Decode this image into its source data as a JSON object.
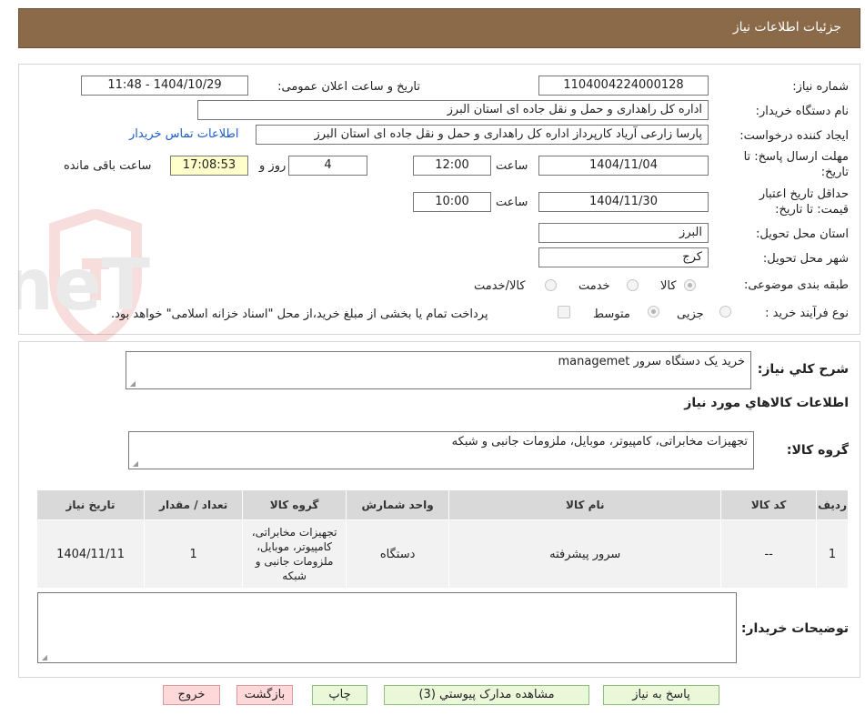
{
  "header": {
    "title": "جزئیات اطلاعات نیاز"
  },
  "form": {
    "need_number": {
      "label": "شماره نیاز:",
      "value": "1104004224000128"
    },
    "announce_datetime": {
      "label": "تاریخ و ساعت اعلان عمومی:",
      "value": "1404/10/29 - 11:48"
    },
    "buyer_org": {
      "label": "نام دستگاه خریدار:",
      "value": "اداره کل راهداری و حمل و نقل جاده ای استان البرز"
    },
    "requester": {
      "label": "ایجاد کننده درخواست:",
      "value": "پارسا زارعی آریاد کارپرداز اداره کل راهداری و حمل و نقل جاده ای استان البرز",
      "contact_link": "اطلاعات تماس خریدار"
    },
    "deadline": {
      "label_line1": "مهلت ارسال پاسخ: تا",
      "label_line2": "تاریخ:",
      "date": "1404/11/04",
      "time_label": "ساعت",
      "time": "12:00",
      "days": "4",
      "days_label": "روز و",
      "remaining": "17:08:53",
      "remaining_label": "ساعت باقی مانده"
    },
    "validity": {
      "label_line1": "حداقل تاریخ اعتبار",
      "label_line2": "قیمت: تا تاریخ:",
      "date": "1404/11/30",
      "time_label": "ساعت",
      "time": "10:00"
    },
    "province": {
      "label": "استان محل تحویل:",
      "value": "البرز"
    },
    "city": {
      "label": "شهر محل تحویل:",
      "value": "کرج"
    },
    "category": {
      "label": "طبقه بندی موضوعی:",
      "options": [
        "کالا",
        "خدمت",
        "کالا/خدمت"
      ]
    },
    "process": {
      "label": "نوع فرآیند خرید :",
      "options": [
        "جزیی",
        "متوسط"
      ],
      "payment_note": "پرداخت تمام یا بخشی از مبلغ خرید،از محل \"اسناد خزانه اسلامی\" خواهد بود."
    }
  },
  "watermark": {
    "text": "AriaTender.neT"
  },
  "summary": {
    "label": "شرح کلي نياز:",
    "value": "خرید یک دستگاه سرور managemet"
  },
  "goods_info": {
    "title": "اطلاعات کالاهاي مورد نياز"
  },
  "goods_group": {
    "label": "گروه کالا:",
    "value": "تجهیزات مخابراتی، کامپیوتر، موبایل، ملزومات جانبی و شبکه"
  },
  "table": {
    "headers": [
      "رديف",
      "کد کالا",
      "نام کالا",
      "واحد شمارش",
      "گروه کالا",
      "تعداد / مقدار",
      "تاريخ نياز"
    ],
    "rows": [
      {
        "row": "1",
        "code": "--",
        "name": "سرور پیشرفته",
        "unit": "دستگاه",
        "group": "تجهیزات مخابراتی، کامپیوتر، موبایل، ملزومات جانبی و شبکه",
        "qty": "1",
        "date": "1404/11/11"
      }
    ]
  },
  "buyer_notes": {
    "label": "توضیحات خریدار:",
    "value": ""
  },
  "buttons": {
    "reply": "پاسخ به نياز",
    "attachments": "مشاهده مدارک پيوستي (3)",
    "print": "چاپ",
    "back": "بازگشت",
    "exit": "خروج"
  }
}
